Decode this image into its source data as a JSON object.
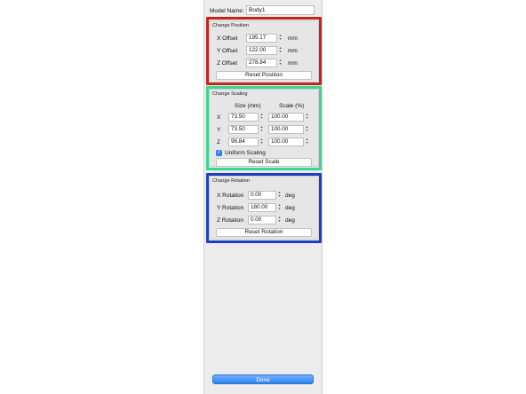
{
  "model": {
    "label": "Model Name:",
    "value": "Body1"
  },
  "position": {
    "title": "Change Position",
    "rows": [
      {
        "label": "X Offset",
        "value": "195.17",
        "unit": "mm"
      },
      {
        "label": "Y Offset",
        "value": "122.00",
        "unit": "mm"
      },
      {
        "label": "Z Offset",
        "value": "278.84",
        "unit": "mm"
      }
    ],
    "reset_label": "Reset Position"
  },
  "scaling": {
    "title": "Change Scaling",
    "size_header": "Size (mm)",
    "scale_header": "Scale (%)",
    "rows": [
      {
        "axis": "X",
        "size": "73.50",
        "scale": "100.00"
      },
      {
        "axis": "Y",
        "size": "73.50",
        "scale": "100.00"
      },
      {
        "axis": "Z",
        "size": "96.84",
        "scale": "100.00"
      }
    ],
    "uniform_label": "Uniform Scaling",
    "uniform_checked": true,
    "reset_label": "Reset Scale"
  },
  "rotation": {
    "title": "Change Rotation",
    "rows": [
      {
        "label": "X Rotation",
        "value": "0.00",
        "unit": "deg"
      },
      {
        "label": "Y Rotation",
        "value": "180.00",
        "unit": "deg"
      },
      {
        "label": "Z Rotation",
        "value": "0.00",
        "unit": "deg"
      }
    ],
    "reset_label": "Reset Rotation"
  },
  "done_label": "Done",
  "colors": {
    "highlight_position": "#c0261f",
    "highlight_scaling": "#3ad68f",
    "highlight_rotation": "#1f3fc0",
    "accent": "#2f7ff5"
  },
  "icons": {
    "stepper": "up-down-arrows-icon",
    "check": "checkmark-icon"
  }
}
